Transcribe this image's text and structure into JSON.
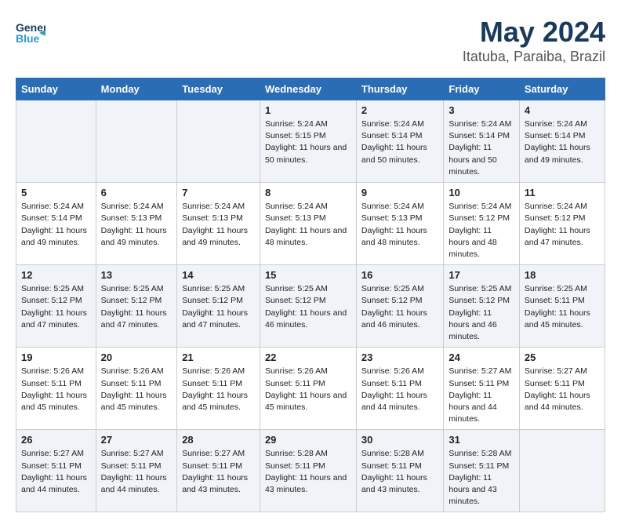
{
  "header": {
    "logo_line1": "General",
    "logo_line2": "Blue",
    "title": "May 2024",
    "subtitle": "Itatuba, Paraiba, Brazil"
  },
  "weekdays": [
    "Sunday",
    "Monday",
    "Tuesday",
    "Wednesday",
    "Thursday",
    "Friday",
    "Saturday"
  ],
  "weeks": [
    [
      {
        "day": "",
        "detail": ""
      },
      {
        "day": "",
        "detail": ""
      },
      {
        "day": "",
        "detail": ""
      },
      {
        "day": "1",
        "detail": "Sunrise: 5:24 AM\nSunset: 5:15 PM\nDaylight: 11 hours\nand 50 minutes."
      },
      {
        "day": "2",
        "detail": "Sunrise: 5:24 AM\nSunset: 5:14 PM\nDaylight: 11 hours\nand 50 minutes."
      },
      {
        "day": "3",
        "detail": "Sunrise: 5:24 AM\nSunset: 5:14 PM\nDaylight: 11 hours\nand 50 minutes."
      },
      {
        "day": "4",
        "detail": "Sunrise: 5:24 AM\nSunset: 5:14 PM\nDaylight: 11 hours\nand 49 minutes."
      }
    ],
    [
      {
        "day": "5",
        "detail": "Sunrise: 5:24 AM\nSunset: 5:14 PM\nDaylight: 11 hours\nand 49 minutes."
      },
      {
        "day": "6",
        "detail": "Sunrise: 5:24 AM\nSunset: 5:13 PM\nDaylight: 11 hours\nand 49 minutes."
      },
      {
        "day": "7",
        "detail": "Sunrise: 5:24 AM\nSunset: 5:13 PM\nDaylight: 11 hours\nand 49 minutes."
      },
      {
        "day": "8",
        "detail": "Sunrise: 5:24 AM\nSunset: 5:13 PM\nDaylight: 11 hours\nand 48 minutes."
      },
      {
        "day": "9",
        "detail": "Sunrise: 5:24 AM\nSunset: 5:13 PM\nDaylight: 11 hours\nand 48 minutes."
      },
      {
        "day": "10",
        "detail": "Sunrise: 5:24 AM\nSunset: 5:12 PM\nDaylight: 11 hours\nand 48 minutes."
      },
      {
        "day": "11",
        "detail": "Sunrise: 5:24 AM\nSunset: 5:12 PM\nDaylight: 11 hours\nand 47 minutes."
      }
    ],
    [
      {
        "day": "12",
        "detail": "Sunrise: 5:25 AM\nSunset: 5:12 PM\nDaylight: 11 hours\nand 47 minutes."
      },
      {
        "day": "13",
        "detail": "Sunrise: 5:25 AM\nSunset: 5:12 PM\nDaylight: 11 hours\nand 47 minutes."
      },
      {
        "day": "14",
        "detail": "Sunrise: 5:25 AM\nSunset: 5:12 PM\nDaylight: 11 hours\nand 47 minutes."
      },
      {
        "day": "15",
        "detail": "Sunrise: 5:25 AM\nSunset: 5:12 PM\nDaylight: 11 hours\nand 46 minutes."
      },
      {
        "day": "16",
        "detail": "Sunrise: 5:25 AM\nSunset: 5:12 PM\nDaylight: 11 hours\nand 46 minutes."
      },
      {
        "day": "17",
        "detail": "Sunrise: 5:25 AM\nSunset: 5:12 PM\nDaylight: 11 hours\nand 46 minutes."
      },
      {
        "day": "18",
        "detail": "Sunrise: 5:25 AM\nSunset: 5:11 PM\nDaylight: 11 hours\nand 45 minutes."
      }
    ],
    [
      {
        "day": "19",
        "detail": "Sunrise: 5:26 AM\nSunset: 5:11 PM\nDaylight: 11 hours\nand 45 minutes."
      },
      {
        "day": "20",
        "detail": "Sunrise: 5:26 AM\nSunset: 5:11 PM\nDaylight: 11 hours\nand 45 minutes."
      },
      {
        "day": "21",
        "detail": "Sunrise: 5:26 AM\nSunset: 5:11 PM\nDaylight: 11 hours\nand 45 minutes."
      },
      {
        "day": "22",
        "detail": "Sunrise: 5:26 AM\nSunset: 5:11 PM\nDaylight: 11 hours\nand 45 minutes."
      },
      {
        "day": "23",
        "detail": "Sunrise: 5:26 AM\nSunset: 5:11 PM\nDaylight: 11 hours\nand 44 minutes."
      },
      {
        "day": "24",
        "detail": "Sunrise: 5:27 AM\nSunset: 5:11 PM\nDaylight: 11 hours\nand 44 minutes."
      },
      {
        "day": "25",
        "detail": "Sunrise: 5:27 AM\nSunset: 5:11 PM\nDaylight: 11 hours\nand 44 minutes."
      }
    ],
    [
      {
        "day": "26",
        "detail": "Sunrise: 5:27 AM\nSunset: 5:11 PM\nDaylight: 11 hours\nand 44 minutes."
      },
      {
        "day": "27",
        "detail": "Sunrise: 5:27 AM\nSunset: 5:11 PM\nDaylight: 11 hours\nand 44 minutes."
      },
      {
        "day": "28",
        "detail": "Sunrise: 5:27 AM\nSunset: 5:11 PM\nDaylight: 11 hours\nand 43 minutes."
      },
      {
        "day": "29",
        "detail": "Sunrise: 5:28 AM\nSunset: 5:11 PM\nDaylight: 11 hours\nand 43 minutes."
      },
      {
        "day": "30",
        "detail": "Sunrise: 5:28 AM\nSunset: 5:11 PM\nDaylight: 11 hours\nand 43 minutes."
      },
      {
        "day": "31",
        "detail": "Sunrise: 5:28 AM\nSunset: 5:11 PM\nDaylight: 11 hours\nand 43 minutes."
      },
      {
        "day": "",
        "detail": ""
      }
    ]
  ]
}
